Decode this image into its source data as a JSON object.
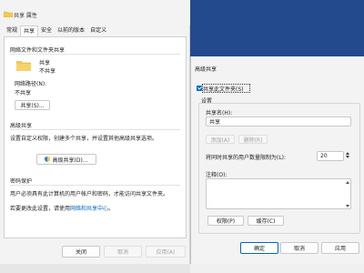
{
  "properties_window": {
    "title": "共享 属性",
    "tabs": [
      "常规",
      "共享",
      "安全",
      "以前的版本",
      "自定义"
    ],
    "active_tab": "共享",
    "network_section": {
      "heading": "网络文件和文件夹共享",
      "folder_name": "共享",
      "share_status": "不共享",
      "path_label": "网络路径(N):",
      "path_value": "不共享",
      "share_button": "共享(S)..."
    },
    "advanced_section": {
      "heading": "高级共享",
      "description": "设置自定义权限，创建多个共享，并设置其他高级共享选项。",
      "button": "高级共享(D)..."
    },
    "password_section": {
      "heading": "密码保护",
      "description": "用户必须具有此计算机的用户帐户和密码，才能访问共享文件夹。",
      "change_prefix": "若要更改此设置，请使用",
      "change_link": "网络和共享中心",
      "change_suffix": "。"
    },
    "buttons": {
      "close": "关闭",
      "cancel": "取消",
      "apply": "应用(A)"
    }
  },
  "advanced_dialog": {
    "title": "高级共享",
    "share_checkbox_label": "共享此文件夹(S)",
    "share_checkbox_checked": true,
    "settings_label": "设置",
    "share_name_label": "共享名(H):",
    "share_name_value": "共享",
    "add_button": "添加(A)",
    "remove_button": "删除(R)",
    "limit_label": "将同时共享的用户数量限制为(L):",
    "limit_value": "20",
    "comments_label": "注释(O):",
    "permissions_button": "权限(P)",
    "caching_button": "缓存(C)",
    "ok_button": "确定",
    "cancel_button": "取消",
    "apply_button": "应用"
  },
  "colors": {
    "accent": "#0067c0",
    "desktop": "#234a8c",
    "folder": "#f2c94c"
  }
}
